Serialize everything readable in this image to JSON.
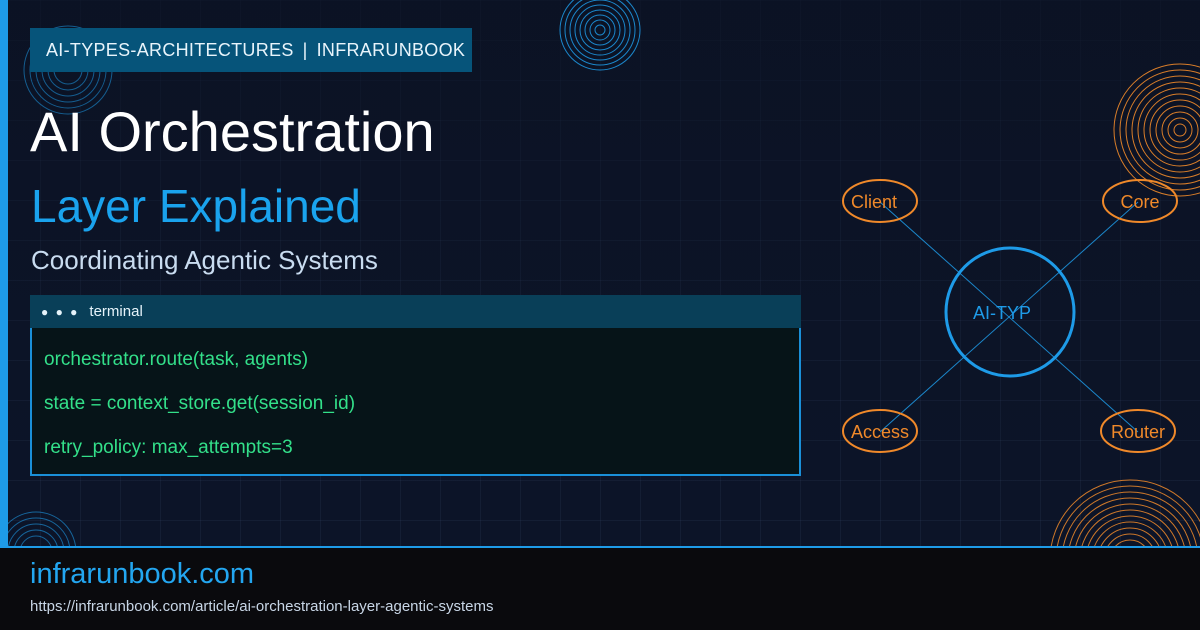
{
  "tag": {
    "category": "AI-TYPES-ARCHITECTURES",
    "separator": "|",
    "site": "INFRARUNBOOK"
  },
  "title": "AI Orchestration",
  "subtitle": "Layer Explained",
  "tagline": "Coordinating Agentic Systems",
  "terminal": {
    "dots": "● ● ●",
    "label": "terminal",
    "lines": [
      "orchestrator.route(task, agents)",
      "state = context_store.get(session_id)",
      "retry_policy: max_attempts=3"
    ]
  },
  "diagram": {
    "center": "AI-TYP",
    "nodes": [
      "Client",
      "Core",
      "Access",
      "Router"
    ]
  },
  "footer": {
    "site": "infrarunbook.com",
    "url": "https://infrarunbook.com/article/ai-orchestration-layer-agentic-systems"
  },
  "colors": {
    "accent": "#1e9be8",
    "node_orange": "#f0892a",
    "terminal_text": "#33e08a",
    "tag_bg": "#06547a"
  }
}
